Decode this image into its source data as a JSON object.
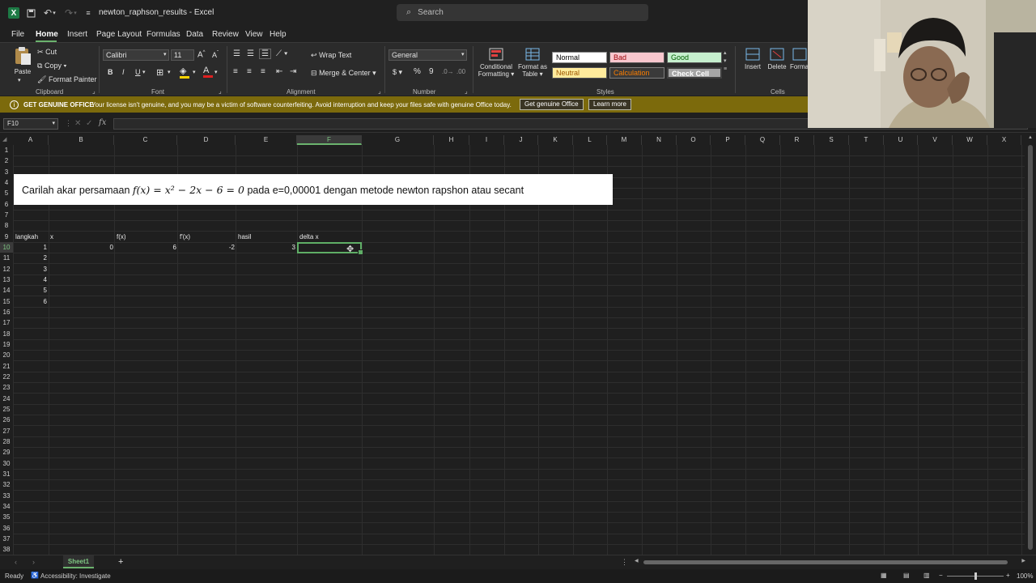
{
  "window": {
    "title": "newton_raphson_results - Excel",
    "search_placeholder": "Search"
  },
  "menu": [
    "File",
    "Home",
    "Insert",
    "Page Layout",
    "Formulas",
    "Data",
    "Review",
    "View",
    "Help"
  ],
  "ribbon": {
    "clipboard": {
      "paste": "Paste",
      "cut": "Cut",
      "copy": "Copy",
      "format_painter": "Format Painter",
      "group": "Clipboard"
    },
    "font": {
      "name": "Calibri",
      "size": "11",
      "group": "Font",
      "bold": "B",
      "italic": "I",
      "underline": "U"
    },
    "alignment": {
      "wrap": "Wrap Text",
      "merge": "Merge & Center",
      "group": "Alignment"
    },
    "number": {
      "format": "General",
      "group": "Number"
    },
    "styles": {
      "conditional": "Conditional",
      "formatting": "Formatting",
      "format_as": "Format as",
      "table": "Table",
      "group": "Styles",
      "cells": [
        {
          "label": "Normal",
          "bg": "#ffffff",
          "fg": "#000000"
        },
        {
          "label": "Bad",
          "bg": "#f8c7ce",
          "fg": "#9c0006"
        },
        {
          "label": "Good",
          "bg": "#c6efce",
          "fg": "#006100"
        },
        {
          "label": "Neutral",
          "bg": "#ffeb9c",
          "fg": "#9c5700"
        },
        {
          "label": "Calculation",
          "bg": "#3a3a3a",
          "fg": "#fa7d00"
        },
        {
          "label": "Check Cell",
          "bg": "#a5a5a5",
          "fg": "#ffffff"
        }
      ]
    },
    "cells": {
      "insert": "Insert",
      "delete": "Delete",
      "format": "Forma",
      "group": "Cells"
    }
  },
  "notification": {
    "title": "GET GENUINE OFFICE",
    "message": "Your license isn't genuine, and you may be a victim of software counterfeiting. Avoid interruption and keep your files safe with genuine Office today.",
    "btn1": "Get genuine Office",
    "btn2": "Learn more"
  },
  "formula_bar": {
    "name_box": "F10",
    "fx": "fx",
    "value": ""
  },
  "columns": [
    "A",
    "B",
    "C",
    "D",
    "E",
    "F",
    "G",
    "H",
    "I",
    "J",
    "K",
    "L",
    "M",
    "N",
    "O",
    "P",
    "Q",
    "R",
    "S",
    "T",
    "U",
    "V",
    "W",
    "X"
  ],
  "rows": [
    "1",
    "2",
    "3",
    "4",
    "5",
    "6",
    "7",
    "8",
    "9",
    "10",
    "11",
    "12",
    "13",
    "14",
    "15",
    "16",
    "17",
    "18",
    "19",
    "20",
    "21",
    "22",
    "23",
    "24",
    "25",
    "26",
    "27",
    "28",
    "29",
    "30",
    "31",
    "32",
    "33",
    "34",
    "35",
    "36",
    "37",
    "38"
  ],
  "banner": {
    "before": "Carilah akar persamaan ",
    "equation": "f(x) = x² − 2x − 6 = 0",
    "after": " pada e=0,00001 dengan metode newton rapshon atau secant"
  },
  "headers": [
    "langkah",
    "x",
    "f(x)",
    "f'(x)",
    "hasil",
    "delta x"
  ],
  "row10": {
    "b": "0",
    "c": "6",
    "d": "-2",
    "e": "3"
  },
  "steps": [
    "1",
    "2",
    "3",
    "4",
    "5",
    "6"
  ],
  "sheet_tab": "Sheet1",
  "status": {
    "ready": "Ready",
    "accessibility": "Accessibility: Investigate",
    "zoom": "100%"
  }
}
